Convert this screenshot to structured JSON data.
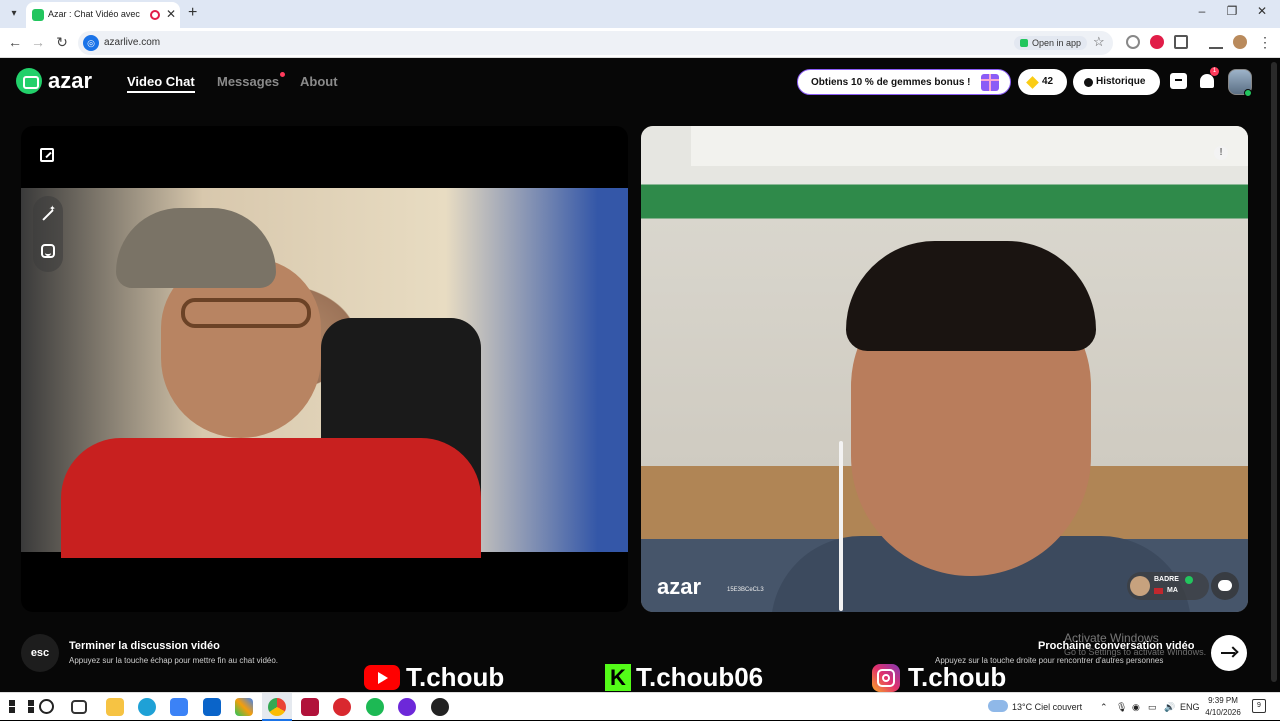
{
  "browser": {
    "tab_title": "Azar : Chat Vidéo avec de n",
    "url": "azarlive.com",
    "open_in_app": "Open in app"
  },
  "header": {
    "logo": "azar",
    "nav": [
      {
        "label": "Video Chat",
        "active": true
      },
      {
        "label": "Messages",
        "active": false,
        "has_dot": true
      },
      {
        "label": "About",
        "active": false
      }
    ],
    "promo": "Obtiens 10 % de gemmes bonus !",
    "gems": "42",
    "history": "Historique",
    "notifications_badge": "1"
  },
  "remote": {
    "watermark_logo": "azar",
    "session_id": "15E3BCeCL3",
    "peer_name": "BADRE",
    "peer_country": "MA",
    "alert": "!"
  },
  "footer": {
    "esc_key": "esc",
    "end_title": "Terminer la discussion vidéo",
    "end_hint": "Appuyez sur la touche échap pour mettre fin au chat vidéo.",
    "next_title": "Prochaine conversation vidéo",
    "next_hint": "Appuyez sur la touche droite pour rencontrer d'autres personnes"
  },
  "windows_watermark": {
    "line1": "Activate Windows",
    "line2": "Go to Settings to activate Windows."
  },
  "overlay": {
    "youtube": "T.choub",
    "kick": "T.choub06",
    "instagram": "T.choub",
    "kick_letter": "K"
  },
  "taskbar": {
    "weather": "13°C  Ciel couvert",
    "language": "ENG",
    "time": "9:39 PM",
    "date": "4/10/2026",
    "notif_count": "9"
  },
  "colors": {
    "brand": "#22d06a",
    "promo_border": "#8b5cf6",
    "badge": "#ff3b5c",
    "youtube": "#ff0000",
    "kick": "#53fc18"
  }
}
